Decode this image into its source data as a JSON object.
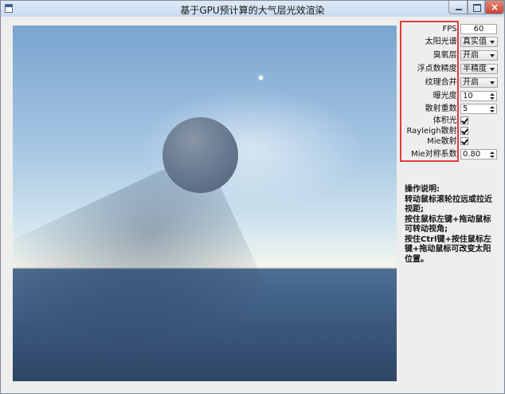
{
  "window": {
    "title": "基于GPU预计算的大气层光效渲染"
  },
  "controls": {
    "fps": {
      "label": "FPS:",
      "value": "60"
    },
    "sun_spectrum": {
      "label": "太阳光谱:",
      "value": "真实值"
    },
    "ozone": {
      "label": "臭氧层:",
      "value": "开启"
    },
    "float_precision": {
      "label": "浮点数精度:",
      "value": "半精度"
    },
    "texture_merge": {
      "label": "纹理合并:",
      "value": "开启"
    },
    "exposure": {
      "label": "曝光度:",
      "value": "10"
    },
    "scatter_orders": {
      "label": "散射重数:",
      "value": "5"
    },
    "volumetric_light": {
      "label": "体积光:",
      "checked": true
    },
    "rayleigh_scatter": {
      "label": "Rayleigh散射:",
      "checked": true
    },
    "mie_scatter": {
      "label": "Mie散射:",
      "checked": true
    },
    "mie_coefficient": {
      "label": "Mie对称系数:",
      "value": "0.80"
    }
  },
  "instructions": {
    "title": "操作说明:",
    "lines": [
      "转动鼠标滚轮拉远或拉近视距;",
      "按住鼠标左键+拖动鼠标可转动视角;",
      "按住Ctrl键+按住鼠标左键+拖动鼠标可改变太阳位置。"
    ]
  },
  "colors": {
    "highlight": "#e33b3b"
  }
}
